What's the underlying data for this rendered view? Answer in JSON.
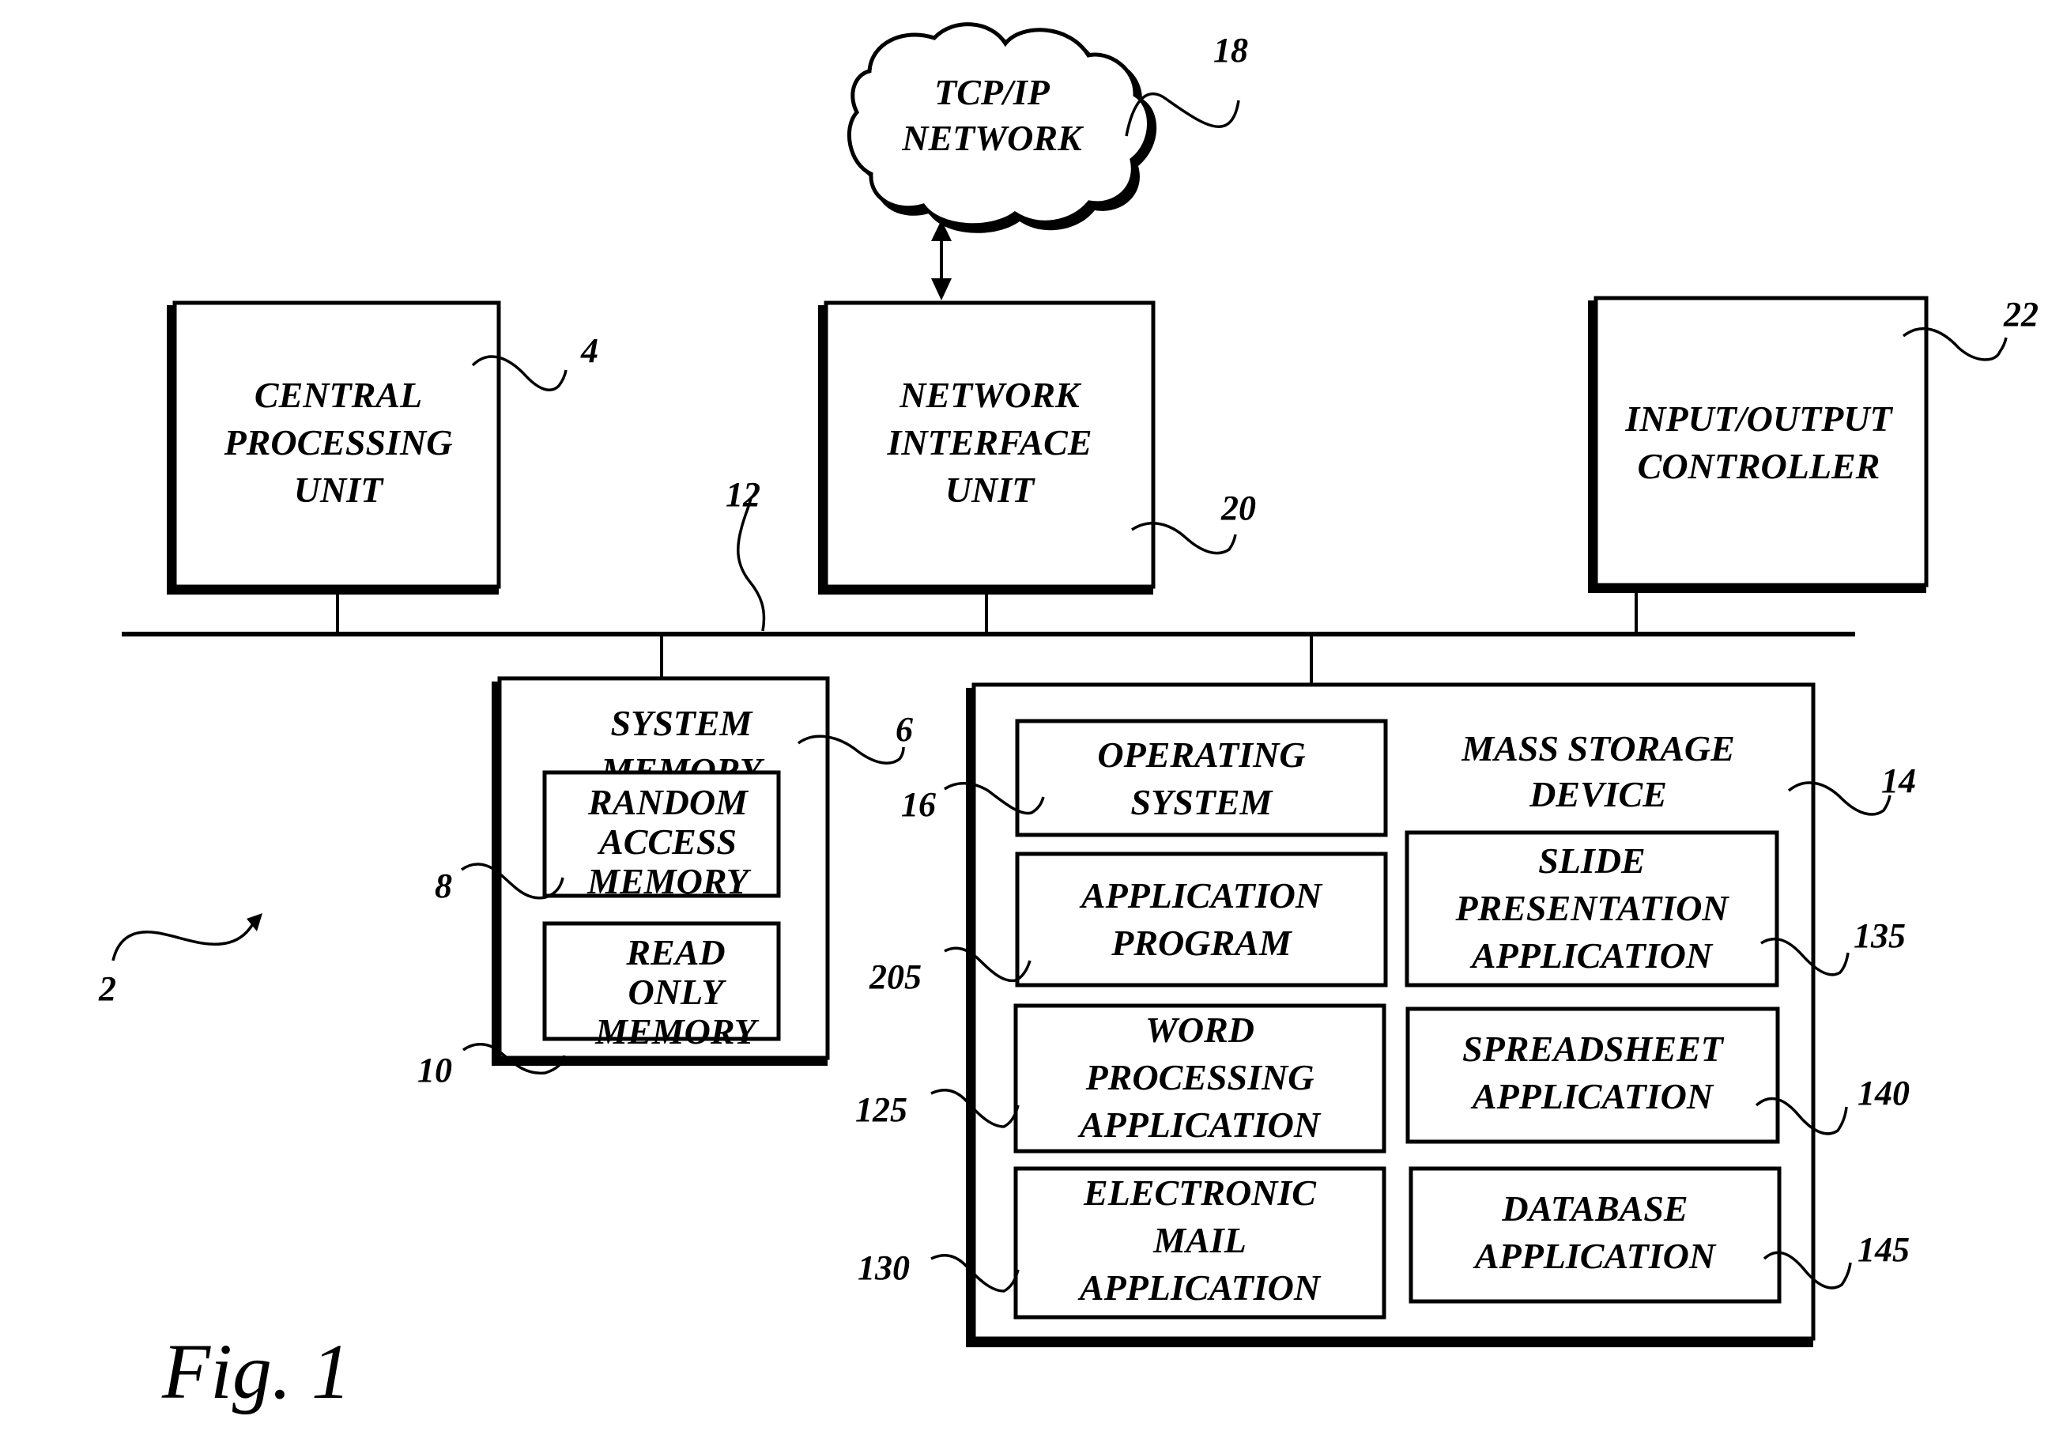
{
  "figure": {
    "caption": "Fig. 1",
    "reference_numeral": "2"
  },
  "colors": {
    "ink": "#000000",
    "paper": "#ffffff"
  },
  "network": {
    "lines": [
      "TCP/IP",
      "NETWORK"
    ],
    "ref": "18"
  },
  "cpu": {
    "lines": [
      "CENTRAL",
      "PROCESSING",
      "UNIT"
    ],
    "ref": "4"
  },
  "niu": {
    "lines": [
      "NETWORK",
      "INTERFACE",
      "UNIT"
    ],
    "ref": "20"
  },
  "io": {
    "lines": [
      "INPUT/OUTPUT",
      "CONTROLLER"
    ],
    "ref": "22"
  },
  "bus": {
    "ref": "12"
  },
  "system_memory": {
    "lines": [
      "SYSTEM",
      "MEMORY"
    ],
    "ref": "6",
    "ram": {
      "lines": [
        "RANDOM",
        "ACCESS",
        "MEMORY"
      ],
      "ref": "8"
    },
    "rom": {
      "lines": [
        "READ",
        "ONLY",
        "MEMORY"
      ],
      "ref": "10"
    }
  },
  "mass_storage": {
    "lines": [
      "MASS STORAGE",
      "DEVICE"
    ],
    "ref": "14",
    "operating_system": {
      "lines": [
        "OPERATING",
        "SYSTEM"
      ],
      "ref": "16"
    },
    "application_program": {
      "lines": [
        "APPLICATION",
        "PROGRAM"
      ],
      "ref": "205"
    },
    "word_processing": {
      "lines": [
        "WORD",
        "PROCESSING",
        "APPLICATION"
      ],
      "ref": "125"
    },
    "email": {
      "lines": [
        "ELECTRONIC",
        "MAIL",
        "APPLICATION"
      ],
      "ref": "130"
    },
    "slide_presentation": {
      "lines": [
        "SLIDE",
        "PRESENTATION",
        "APPLICATION"
      ],
      "ref": "135"
    },
    "spreadsheet": {
      "lines": [
        "SPREADSHEET",
        "APPLICATION"
      ],
      "ref": "140"
    },
    "database": {
      "lines": [
        "DATABASE",
        "APPLICATION"
      ],
      "ref": "145"
    }
  }
}
